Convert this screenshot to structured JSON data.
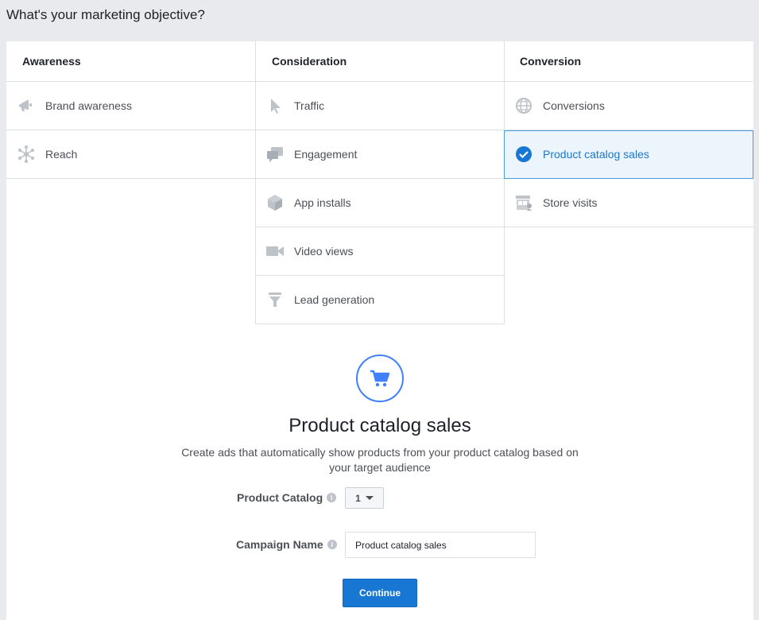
{
  "page": {
    "title": "What's your marketing objective?"
  },
  "columns": [
    {
      "header": "Awareness",
      "items": [
        {
          "label": "Brand awareness",
          "icon": "megaphone-icon"
        },
        {
          "label": "Reach",
          "icon": "reach-icon"
        }
      ]
    },
    {
      "header": "Consideration",
      "items": [
        {
          "label": "Traffic",
          "icon": "cursor-icon"
        },
        {
          "label": "Engagement",
          "icon": "chat-bubbles-icon"
        },
        {
          "label": "App installs",
          "icon": "cube-icon"
        },
        {
          "label": "Video views",
          "icon": "video-camera-icon"
        },
        {
          "label": "Lead generation",
          "icon": "funnel-icon"
        }
      ]
    },
    {
      "header": "Conversion",
      "items": [
        {
          "label": "Conversions",
          "icon": "globe-icon"
        },
        {
          "label": "Product catalog sales",
          "icon": "checkmark-icon",
          "selected": true
        },
        {
          "label": "Store visits",
          "icon": "store-icon"
        }
      ]
    }
  ],
  "detail": {
    "icon": "shopping-cart-icon",
    "title": "Product catalog sales",
    "description": "Create ads that automatically show products from your product catalog based on your target audience",
    "catalog_label": "Product Catalog",
    "catalog_value": "1",
    "campaign_label": "Campaign Name",
    "campaign_value": "Product catalog sales",
    "continue_label": "Continue"
  },
  "colors": {
    "accent": "#1877d2",
    "selected_bg": "#ecf5fb",
    "icon_gray": "#bec2c9",
    "cart_ring": "#4080ff"
  }
}
